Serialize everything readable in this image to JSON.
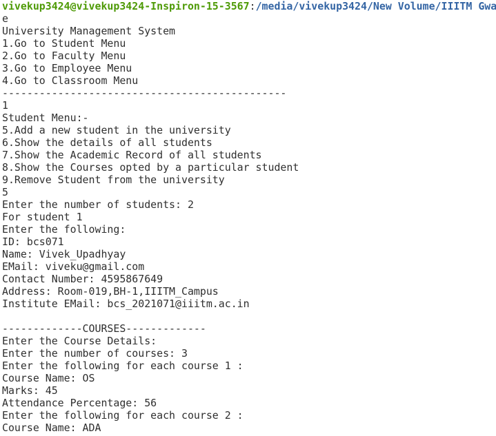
{
  "prompt": {
    "user_host": "vivekup3424@vivekup3424-Inspiron-15-3567",
    "separator": ":",
    "path": "/media/vivekup3424/New Volume/IIITM Gwa",
    "wrap": "e"
  },
  "lines": [
    "University Management System",
    "1.Go to Student Menu",
    "2.Go to Faculty Menu",
    "3.Go to Employee Menu",
    "4.Go to Classroom Menu",
    "----------------------------------------------",
    "1",
    "Student Menu:-",
    "5.Add a new student in the university",
    "6.Show the details of all students",
    "7.Show the Academic Record of all students",
    "8.Show the Courses opted by a particular student",
    "9.Remove Student from the university",
    "5",
    "Enter the number of students: 2",
    "For student 1",
    "Enter the following:",
    "ID: bcs071",
    "Name: Vivek_Upadhyay",
    "EMail: viveku@gmail.com",
    "Contact Number: 4595867649",
    "Address: Room-019,BH-1,IIITM_Campus",
    "Institute EMail: bcs_2021071@iiitm.ac.in",
    "",
    "-------------COURSES-------------",
    "Enter the Course Details:",
    "Enter the number of courses: 3",
    "Enter the following for each course 1 :",
    "Course Name: OS",
    "Marks: 45",
    "Attendance Percentage: 56",
    "Enter the following for each course 2 :",
    "Course Name: ADA"
  ]
}
